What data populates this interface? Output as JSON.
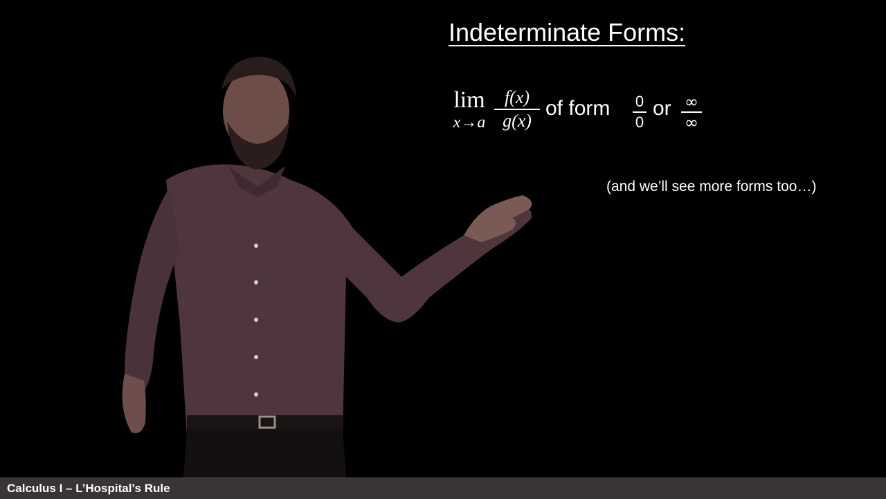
{
  "slide": {
    "heading": "Indeterminate Forms:",
    "math": {
      "lim": "lim",
      "lim_sub": "x→a",
      "numerator": "f(x)",
      "denominator": "g(x)",
      "text_of_form": "of form",
      "zero_num": "0",
      "zero_den": "0",
      "text_or": "or",
      "inf_num": "∞",
      "inf_den": "∞"
    },
    "note": "(and we’ll see more forms too…)"
  },
  "footer": {
    "course_title": "Calculus I – L’Hospital’s Rule"
  },
  "colors": {
    "background": "#000000",
    "text": "#ffffff",
    "footer_bar": "#3a3535",
    "presenter_shirt": "#5a3f45"
  }
}
